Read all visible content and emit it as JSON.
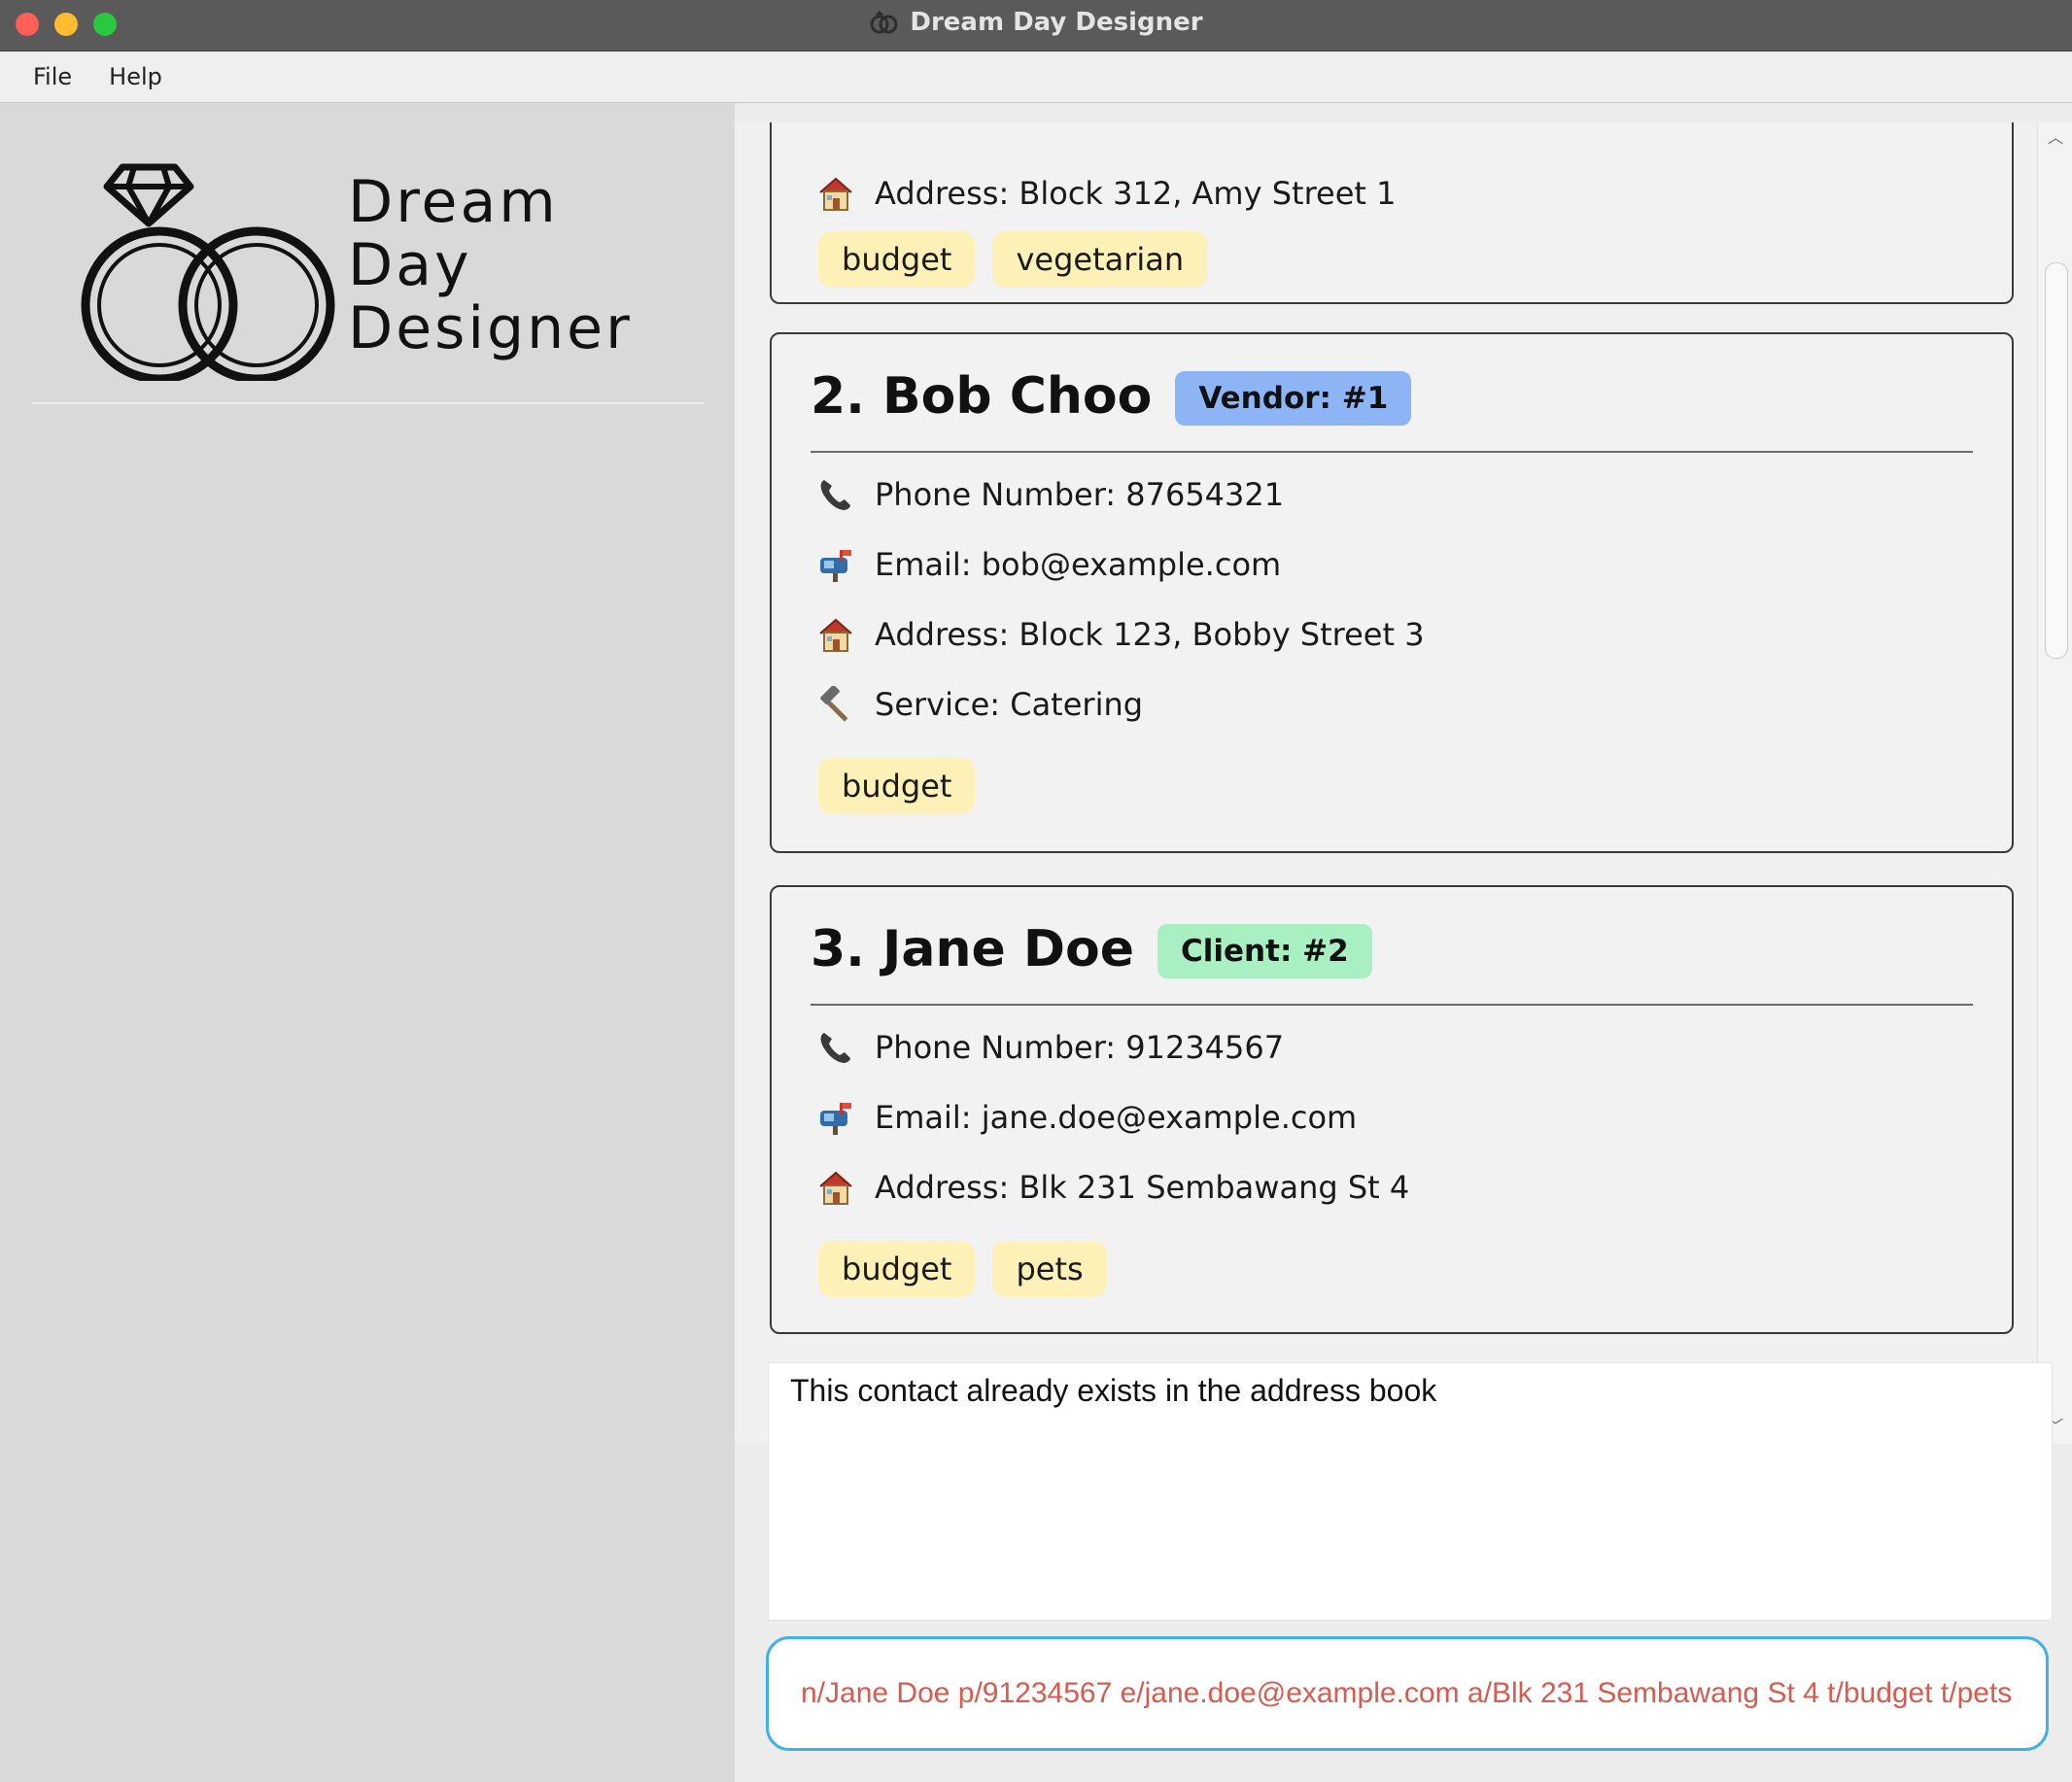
{
  "window": {
    "title": "Dream Day Designer",
    "traffic_lights": [
      "close",
      "minimize",
      "maximize"
    ]
  },
  "menu": {
    "items": [
      "File",
      "Help"
    ]
  },
  "sidebar": {
    "logo_lines": [
      "Dream",
      "Day",
      "Designer"
    ],
    "logo_icon": "wedding-rings-icon"
  },
  "contacts": [
    {
      "address": "Address: Block 312, Amy Street 1",
      "tags": [
        "budget",
        "vegetarian"
      ]
    },
    {
      "name": "2. Bob Choo",
      "role": "Vendor: #1",
      "role_color": "#8db4f5",
      "phone": "Phone Number: 87654321",
      "email": "Email: bob@example.com",
      "address": "Address: Block 123, Bobby Street 3",
      "service": "Service: Catering",
      "tags": [
        "budget"
      ]
    },
    {
      "name": "3. Jane Doe",
      "role": "Client: #2",
      "role_color": "#a8efc2",
      "phone": "Phone Number: 91234567",
      "email": "Email: jane.doe@example.com",
      "address": "Address: Blk 231 Sembawang St 4",
      "tags": [
        "budget",
        "pets"
      ]
    }
  ],
  "icons": {
    "phone": "phone-icon",
    "email": "mailbox-icon",
    "address": "house-icon",
    "service": "hammer-icon"
  },
  "result": {
    "message": "This contact already exists in the address book"
  },
  "command": {
    "value": "n/Jane Doe p/91234567 e/jane.doe@example.com a/Blk 231 Sembawang St 4 t/budget t/pets",
    "text_color": "#d95a4e",
    "border_color": "#3fb3e7"
  }
}
